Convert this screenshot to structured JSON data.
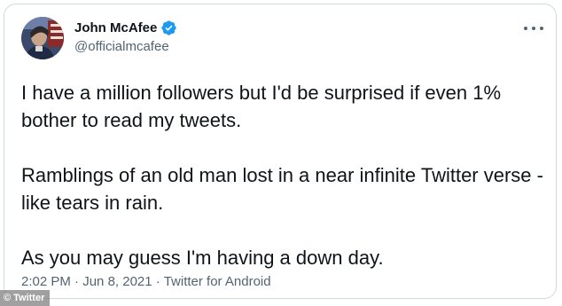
{
  "tweet": {
    "author": {
      "display_name": "John McAfee",
      "handle": "@officialmcafee",
      "verified": true,
      "avatar_icon": "profile-photo"
    },
    "more_icon": "ellipsis-icon",
    "text_paragraphs": [
      "I have a million followers but I'd be surprised if even 1% bother to read my tweets.",
      "Ramblings of an old man lost in a near infinite Twitter verse - like tears in rain.",
      "As you may guess I'm having a down day."
    ],
    "time": "2:02 PM",
    "separator": "·",
    "date": "Jun 8, 2021",
    "source": "Twitter for Android"
  },
  "watermark": {
    "symbol": "©",
    "text": "Twitter"
  },
  "colors": {
    "verified_blue": "#1d9bf0",
    "text_primary": "#0f1419",
    "text_secondary": "#536471",
    "border": "#cfd9de"
  }
}
